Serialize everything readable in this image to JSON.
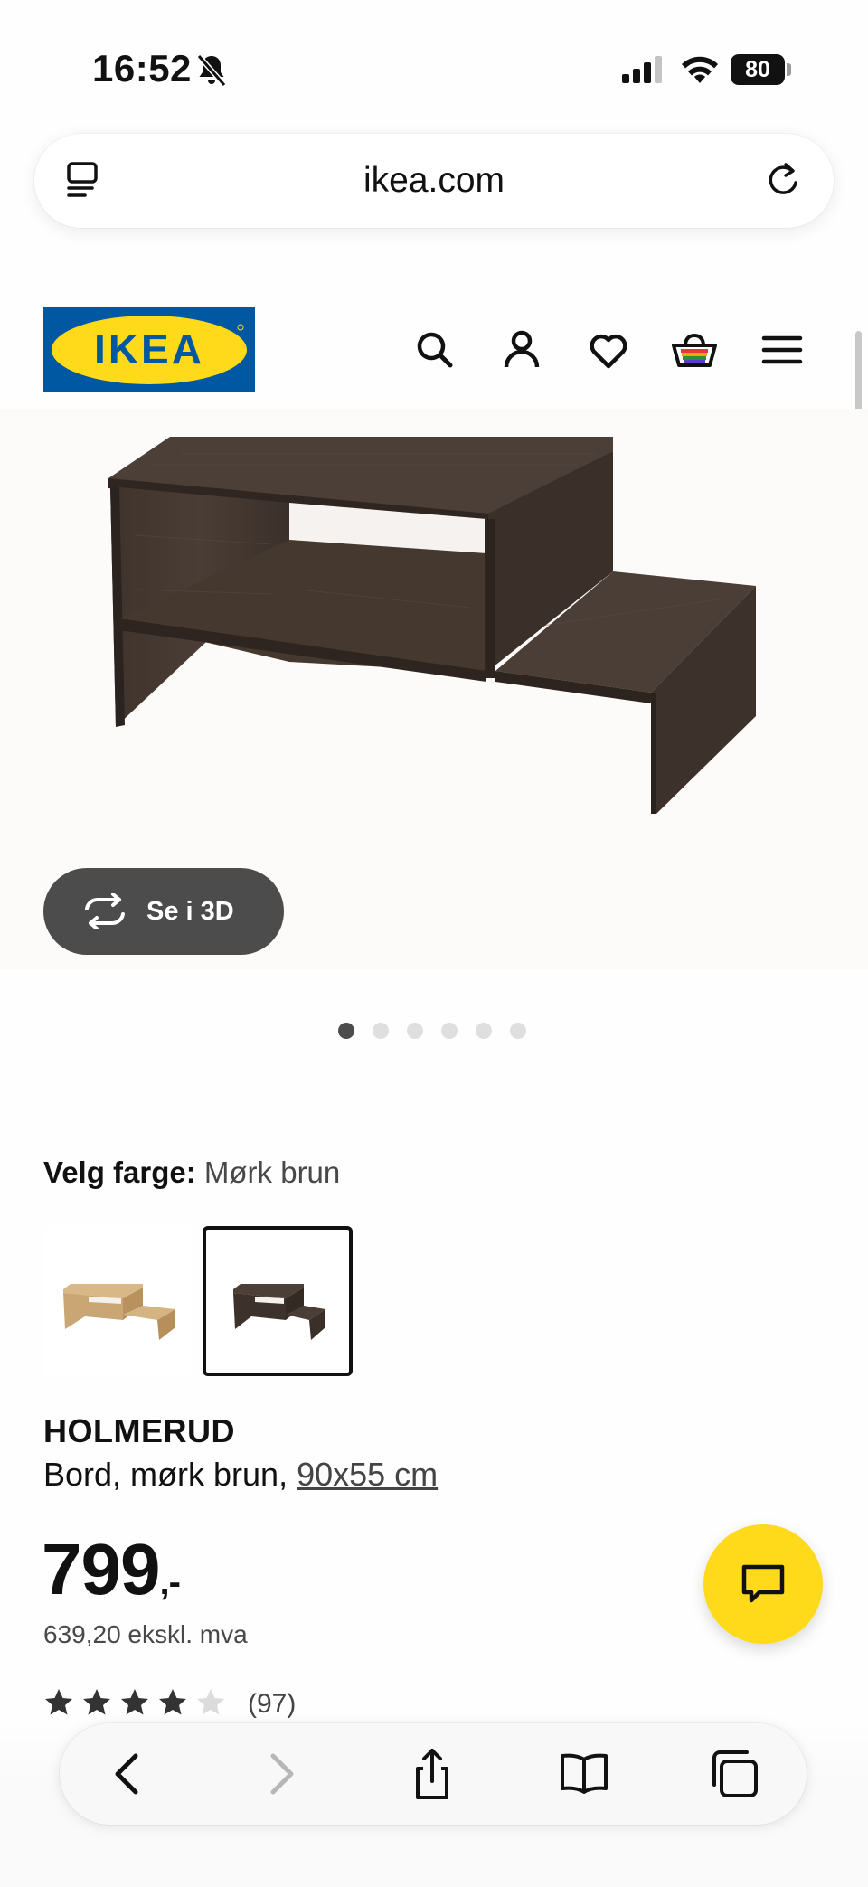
{
  "status_bar": {
    "time": "16:52",
    "battery": "80"
  },
  "browser": {
    "url": "ikea.com"
  },
  "ikea": {
    "logo_text": "IKEA",
    "brand_colors": {
      "blue": "#0058a3",
      "yellow": "#ffda1a"
    }
  },
  "nav_icons": [
    "search-icon",
    "account-icon",
    "heart-icon",
    "basket-icon",
    "menu-icon"
  ],
  "gallery": {
    "view_3d_label": "Se i 3D",
    "image_count": 6,
    "active_index": 0
  },
  "color_select": {
    "label": "Velg farge:",
    "value": "Mørk brun",
    "options": [
      "light-oak",
      "dark-brown"
    ],
    "selected_index": 1
  },
  "product": {
    "name": "HOLMERUD",
    "description": "Bord, mørk brun,",
    "dimensions": "90x55 cm",
    "price": "799",
    "price_suffix": ",-",
    "price_ex_vat": "639,20 ekskl. mva",
    "rating": 4.5,
    "rating_count": "(97)"
  },
  "browser_toolbar": [
    "back-icon",
    "forward-icon",
    "share-icon",
    "bookmarks-icon",
    "tabs-icon"
  ]
}
